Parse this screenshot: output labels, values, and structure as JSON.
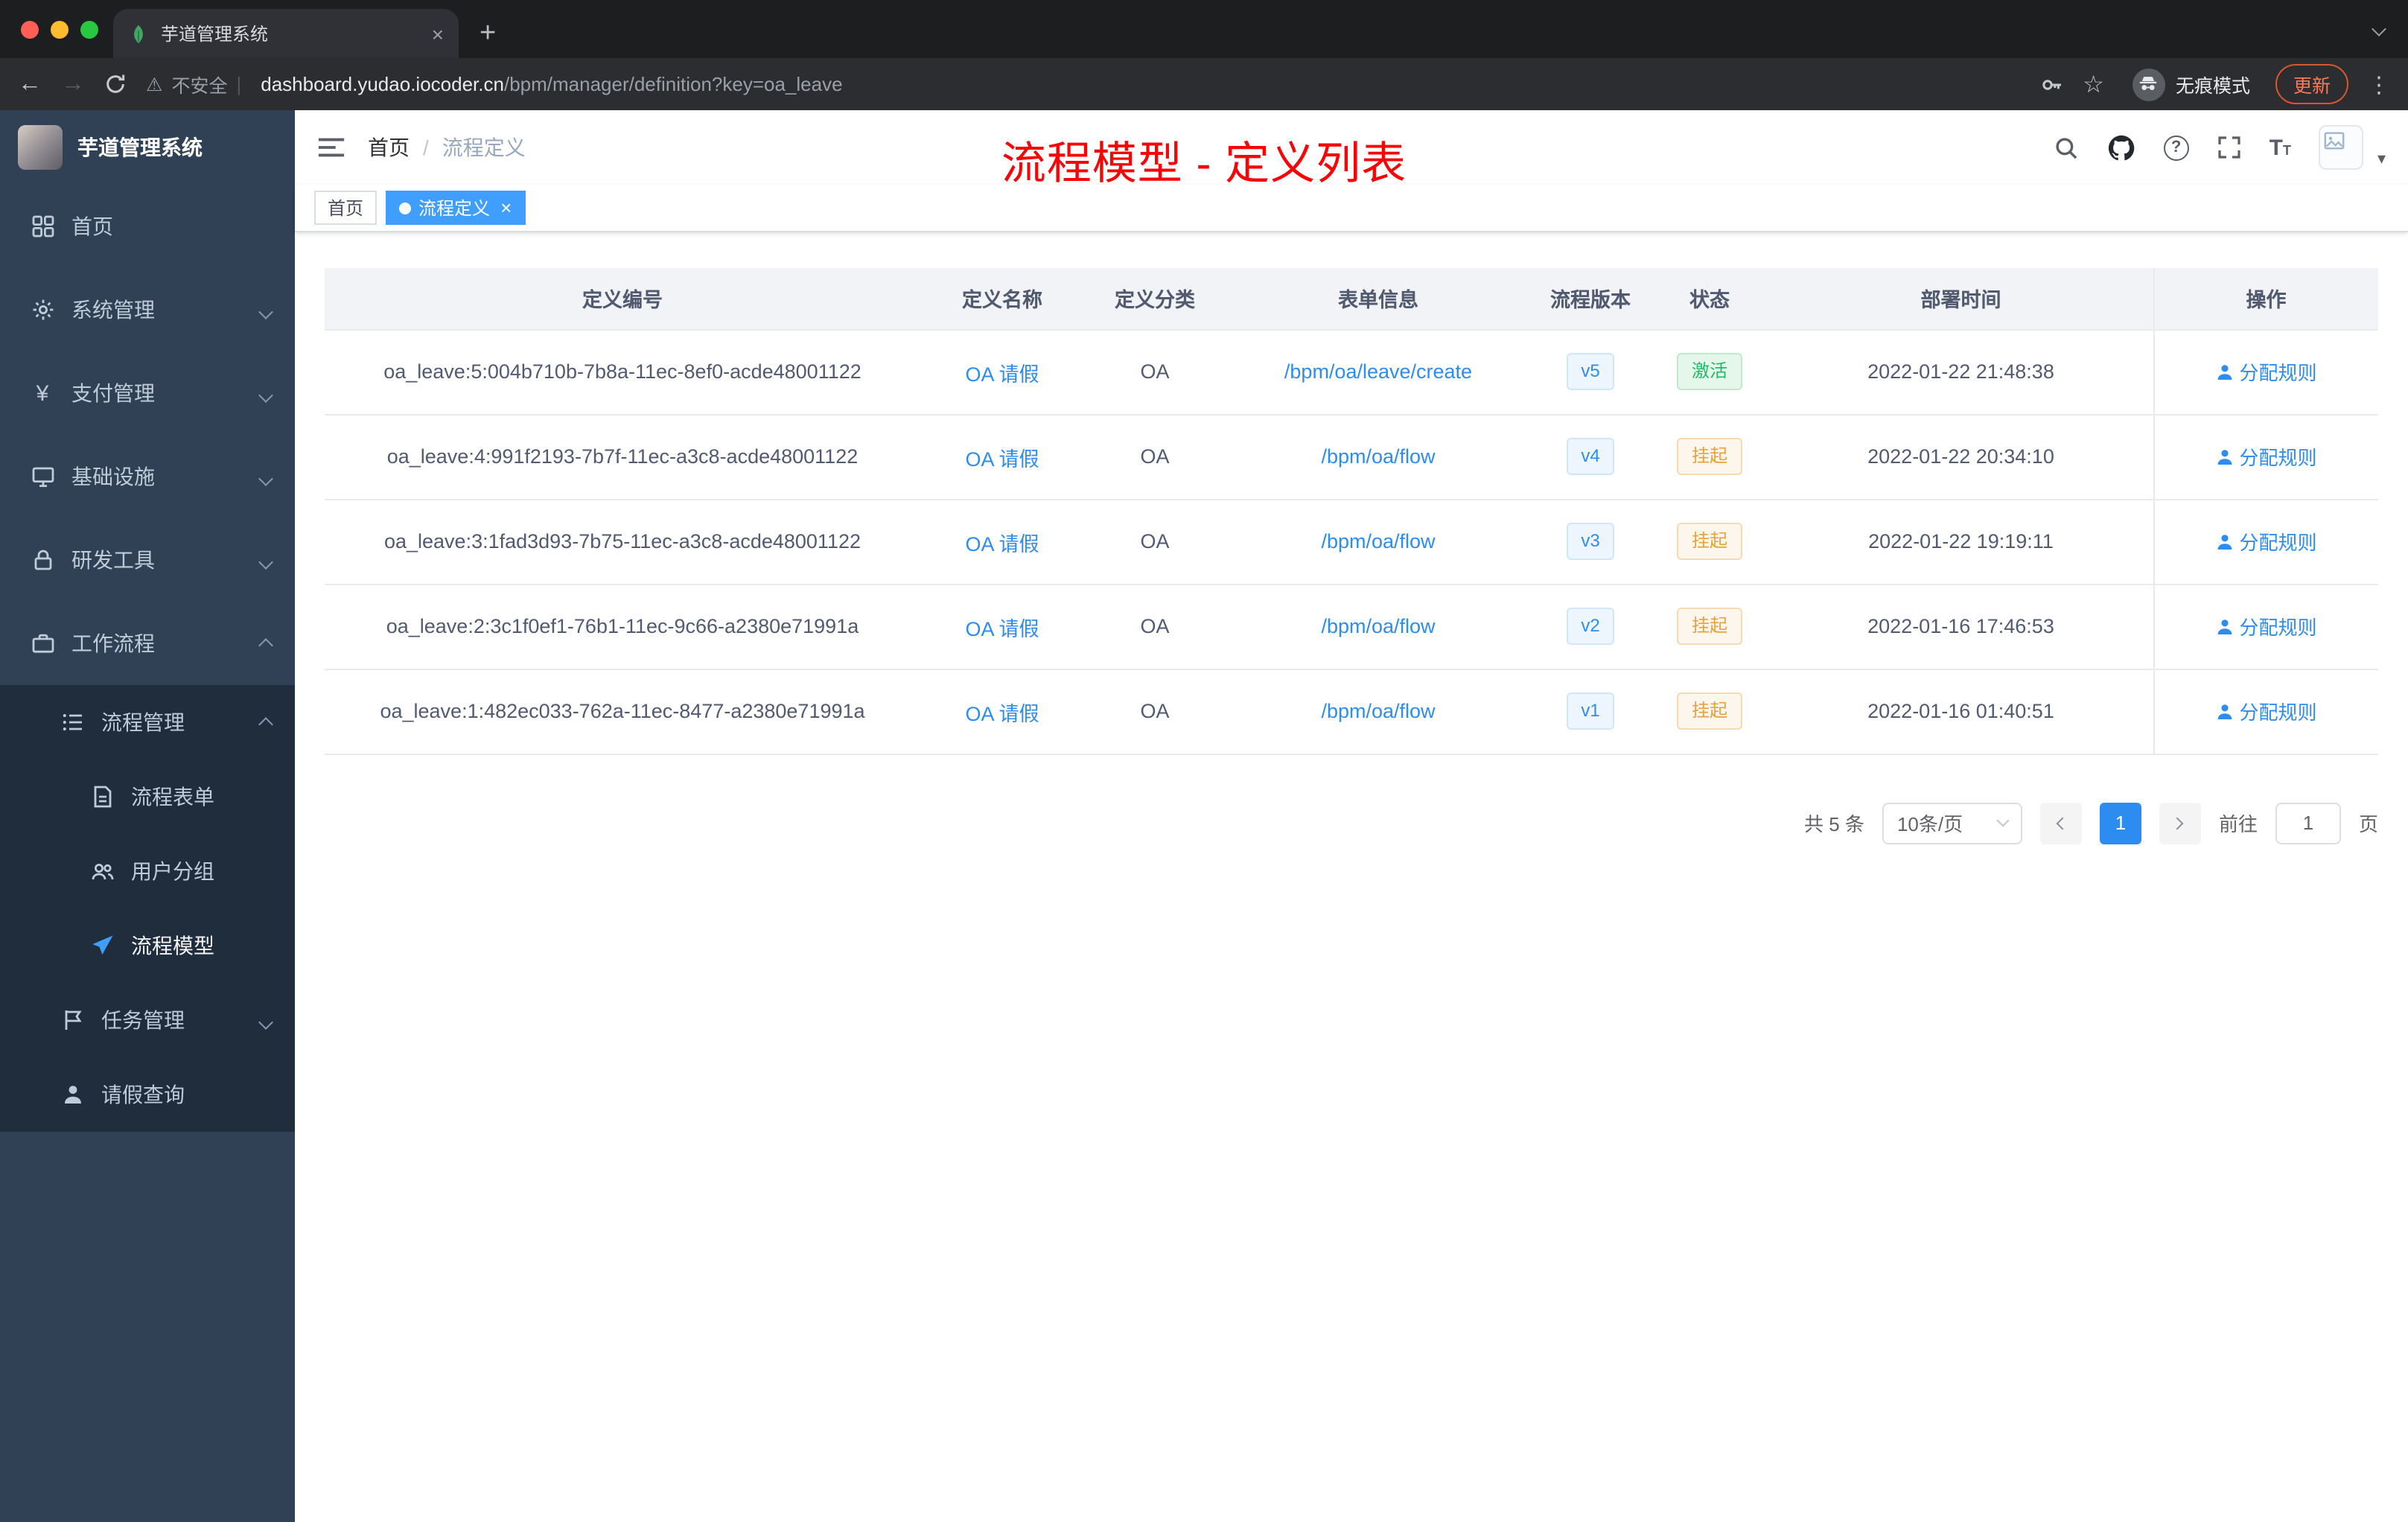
{
  "browser": {
    "tab_title": "芋道管理系统",
    "new_tab": "+",
    "close_tab": "×",
    "back": "←",
    "forward": "→",
    "security_label": "不安全",
    "url_host": "dashboard.yudao.iocoder.cn",
    "url_path": "/bpm/manager/definition?key=oa_leave",
    "incognito_label": "无痕模式",
    "update_label": "更新",
    "kebab": "⋮"
  },
  "sidebar": {
    "logo_title": "芋道管理系统",
    "items": [
      {
        "label": "首页"
      },
      {
        "label": "系统管理"
      },
      {
        "label": "支付管理"
      },
      {
        "label": "基础设施"
      },
      {
        "label": "研发工具"
      },
      {
        "label": "工作流程"
      },
      {
        "label": "流程管理"
      },
      {
        "label": "流程表单"
      },
      {
        "label": "用户分组"
      },
      {
        "label": "流程模型"
      },
      {
        "label": "任务管理"
      },
      {
        "label": "请假查询"
      }
    ]
  },
  "header": {
    "breadcrumb": [
      "首页",
      "流程定义"
    ],
    "annotation": "流程模型 - 定义列表"
  },
  "tags": [
    {
      "label": "首页"
    },
    {
      "label": "流程定义"
    }
  ],
  "table": {
    "columns": [
      "定义编号",
      "定义名称",
      "定义分类",
      "表单信息",
      "流程版本",
      "状态",
      "部署时间",
      "操作"
    ],
    "rows": [
      {
        "id": "oa_leave:5:004b710b-7b8a-11ec-8ef0-acde48001122",
        "name": "OA 请假",
        "category": "OA",
        "form": "/bpm/oa/leave/create",
        "version": "v5",
        "status": "激活",
        "time": "2022-01-22 21:48:38",
        "action": "分配规则"
      },
      {
        "id": "oa_leave:4:991f2193-7b7f-11ec-a3c8-acde48001122",
        "name": "OA 请假",
        "category": "OA",
        "form": "/bpm/oa/flow",
        "version": "v4",
        "status": "挂起",
        "time": "2022-01-22 20:34:10",
        "action": "分配规则"
      },
      {
        "id": "oa_leave:3:1fad3d93-7b75-11ec-a3c8-acde48001122",
        "name": "OA 请假",
        "category": "OA",
        "form": "/bpm/oa/flow",
        "version": "v3",
        "status": "挂起",
        "time": "2022-01-22 19:19:11",
        "action": "分配规则"
      },
      {
        "id": "oa_leave:2:3c1f0ef1-76b1-11ec-9c66-a2380e71991a",
        "name": "OA 请假",
        "category": "OA",
        "form": "/bpm/oa/flow",
        "version": "v2",
        "status": "挂起",
        "time": "2022-01-16 17:46:53",
        "action": "分配规则"
      },
      {
        "id": "oa_leave:1:482ec033-762a-11ec-8477-a2380e71991a",
        "name": "OA 请假",
        "category": "OA",
        "form": "/bpm/oa/flow",
        "version": "v1",
        "status": "挂起",
        "time": "2022-01-16 01:40:51",
        "action": "分配规则"
      }
    ]
  },
  "pagination": {
    "total": "共 5 条",
    "page_size": "10条/页",
    "current_page": "1",
    "goto_label": "前往",
    "goto_value": "1",
    "page_label": "页"
  },
  "colors": {
    "accent": "#2d8cf0",
    "active_tag": "#409eff",
    "sidebar_bg": "#304156",
    "submenu_bg": "#1f2d3d",
    "annotation_red": "#f80406",
    "success": "#19be6b",
    "warning": "#e6a23c"
  }
}
